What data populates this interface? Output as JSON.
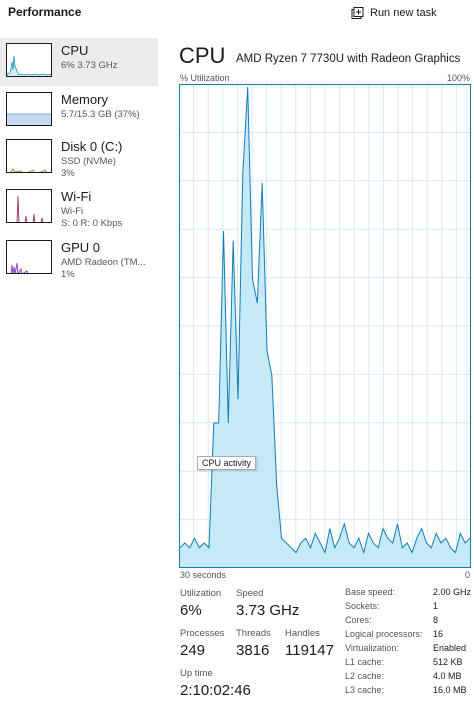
{
  "header": {
    "title": "Performance",
    "run_new_task": "Run new task"
  },
  "sidebar": {
    "items": [
      {
        "name": "CPU",
        "line1": "6% 3.73 GHz",
        "line2": "",
        "border_color": "#1a91b8",
        "fill_color": "#cfeef8"
      },
      {
        "name": "Memory",
        "line1": "5.7/15.3 GB (37%)",
        "line2": "",
        "border_color": "#5f8fc7",
        "fill_color": "#c5d9f1",
        "level": 0.37
      },
      {
        "name": "Disk 0 (C:)",
        "line1": "SSD (NVMe)",
        "line2": "3%",
        "border_color": "#5c9a3a",
        "fill_color": "#dff0d2"
      },
      {
        "name": "Wi-Fi",
        "line1": "Wi-Fi",
        "line2": "S: 0 R: 0 Kbps",
        "border_color": "#a0366b",
        "fill_color": "#f2dbe6"
      },
      {
        "name": "GPU 0",
        "line1": "AMD Radeon (TM...",
        "line2": "1%",
        "border_color": "#8a3fb5",
        "fill_color": "#ead9f5"
      }
    ]
  },
  "main": {
    "title": "CPU",
    "model": "AMD Ryzen 7 7730U with Radeon Graphics",
    "util_label": "% Utilization",
    "util_max": "100%",
    "time_left": "30 seconds",
    "time_right": "0",
    "tooltip": "CPU activity",
    "colors": {
      "line": "#117dbb",
      "fill": "#c6e9f7",
      "grid": "#d9eaf4"
    }
  },
  "chart_data": {
    "type": "area",
    "title": "",
    "xlabel": "",
    "ylabel": "% Utilization",
    "xlim": [
      30,
      0
    ],
    "ylim": [
      0,
      100
    ],
    "grid": true,
    "x": [
      30,
      29.5,
      29,
      28.5,
      28,
      27.5,
      27,
      26.5,
      26,
      25.5,
      25,
      24.5,
      24,
      23.5,
      23,
      22.5,
      22,
      21.5,
      21,
      20.5,
      20,
      19.5,
      19,
      18.5,
      18,
      17.5,
      17,
      16.5,
      16,
      15.5,
      15,
      14.5,
      14,
      13.5,
      13,
      12.5,
      12,
      11.5,
      11,
      10.5,
      10,
      9.5,
      9,
      8.5,
      8,
      7.5,
      7,
      6.5,
      6,
      5.5,
      5,
      4.5,
      4,
      3.5,
      3,
      2.5,
      2,
      1.5,
      1,
      0.5,
      0
    ],
    "series": [
      {
        "values": [
          4,
          5,
          4,
          6,
          4,
          5,
          4,
          30,
          30,
          70,
          30,
          68,
          35,
          82,
          100,
          60,
          55,
          80,
          45,
          40,
          17,
          6,
          5,
          4,
          3,
          5,
          6,
          4,
          7,
          5,
          3,
          8,
          4,
          6,
          9,
          5,
          4,
          6,
          3,
          7,
          5,
          4,
          8,
          6,
          5,
          9,
          4,
          5,
          3,
          6,
          8,
          5,
          4,
          7,
          5,
          6,
          4,
          3,
          7,
          5,
          6
        ]
      }
    ]
  },
  "stats": {
    "utilization": {
      "label": "Utilization",
      "value": "6%"
    },
    "speed": {
      "label": "Speed",
      "value": "3.73 GHz"
    },
    "processes": {
      "label": "Processes",
      "value": "249"
    },
    "threads": {
      "label": "Threads",
      "value": "3816"
    },
    "handles": {
      "label": "Handles",
      "value": "119147"
    },
    "uptime": {
      "label": "Up time",
      "value": "2:10:02:46"
    }
  },
  "info": [
    {
      "key": "Base speed:",
      "value": "2.00 GHz"
    },
    {
      "key": "Sockets:",
      "value": "1"
    },
    {
      "key": "Cores:",
      "value": "8"
    },
    {
      "key": "Logical processors:",
      "value": "16"
    },
    {
      "key": "Virtualization:",
      "value": "Enabled"
    },
    {
      "key": "L1 cache:",
      "value": "512 KB"
    },
    {
      "key": "L2 cache:",
      "value": "4.0 MB"
    },
    {
      "key": "L3 cache:",
      "value": "16.0 MB"
    }
  ]
}
